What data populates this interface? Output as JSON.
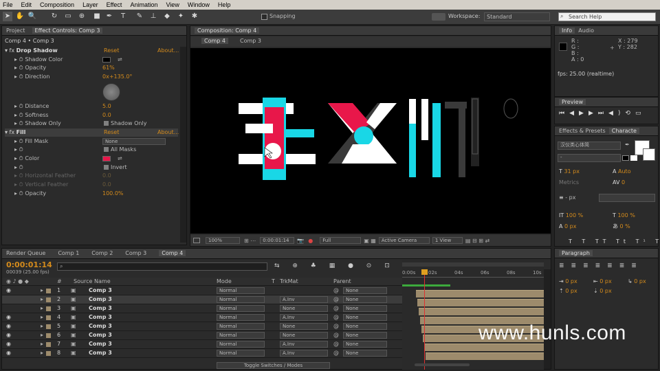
{
  "menu": [
    "File",
    "Edit",
    "Composition",
    "Layer",
    "Effect",
    "Animation",
    "View",
    "Window",
    "Help"
  ],
  "toolbar": {
    "snapping": "Snapping",
    "workspace_label": "Workspace:",
    "workspace_value": "Standard",
    "search_placeholder": "Search Help"
  },
  "project_panel": {
    "tab_project": "Project",
    "tab_effect_controls": "Effect Controls: Comp 3",
    "breadcrumb": "Comp 4 • Comp 3",
    "effects": [
      {
        "name": "Drop Shadow",
        "reset": "Reset",
        "about": "About...",
        "props": [
          {
            "label": "Shadow Color",
            "value": ""
          },
          {
            "label": "Opacity",
            "value": "61%"
          },
          {
            "label": "Direction",
            "value": "0x+135.0°"
          },
          {
            "label": "Distance",
            "value": "5.0"
          },
          {
            "label": "Softness",
            "value": "0.0"
          },
          {
            "label": "Shadow Only",
            "value": "Shadow Only"
          }
        ]
      },
      {
        "name": "Fill",
        "reset": "Reset",
        "about": "About...",
        "props": [
          {
            "label": "Fill Mask",
            "value": "None"
          },
          {
            "label": "",
            "value": "All Masks"
          },
          {
            "label": "Color",
            "value": ""
          },
          {
            "label": "",
            "value": "Invert"
          },
          {
            "label": "Horizontal Feather",
            "value": "0.0"
          },
          {
            "label": "Vertical Feather",
            "value": "0.0"
          },
          {
            "label": "Opacity",
            "value": "100.0%"
          }
        ]
      }
    ]
  },
  "composition_panel": {
    "tab": "Composition: Comp 4",
    "subtabs": [
      "Comp 4",
      "Comp 3"
    ],
    "footer": {
      "zoom": "100%",
      "timecode": "0:00:01:14",
      "resolution": "Full",
      "camera": "Active Camera",
      "view": "1 View"
    }
  },
  "info_panel": {
    "tab_info": "Info",
    "tab_audio": "Audio",
    "r": "R :",
    "g": "G :",
    "b": "B :",
    "a": "A : 0",
    "x": "X : 279",
    "y": "Y : 282",
    "fps": "fps: 25.00 (realtime)"
  },
  "preview_panel": {
    "tab": "Preview"
  },
  "effects_presets": {
    "tab1": "Effects & Presets",
    "tab2": "Characte"
  },
  "character": {
    "font": "汉仪类心体简",
    "style": "-",
    "size": "31 px",
    "leading": "Auto",
    "kerning": "Metrics",
    "tracking": "0",
    "stroke": "- px",
    "vscale": "100 %",
    "hscale": "100 %",
    "baseline": "0 px",
    "tsume": "0 %"
  },
  "paragraph": {
    "tab": "Paragraph",
    "indent_vals": [
      "0 px",
      "0 px",
      "0 px",
      "0 px",
      "0 px"
    ]
  },
  "timeline": {
    "tabs": [
      "Render Queue",
      "Comp 1",
      "Comp 2",
      "Comp 3",
      "Comp 4"
    ],
    "timecode": "0:00:01:14",
    "frames": "00039 (25.00 fps)",
    "columns": {
      "source": "Source Name",
      "mode": "Mode",
      "t": "T",
      "trkmat": "TrkMat",
      "parent": "Parent"
    },
    "ruler": [
      "0:00s",
      "02s",
      "04s",
      "06s",
      "08s",
      "10s"
    ],
    "layers": [
      {
        "num": "1",
        "name": "Comp 3",
        "mode": "Normal",
        "trkmat": "",
        "parent": "None",
        "selected": false
      },
      {
        "num": "2",
        "name": "Comp 3",
        "mode": "Normal",
        "trkmat": "A.Inv",
        "parent": "None",
        "selected": true
      },
      {
        "num": "3",
        "name": "Comp 3",
        "mode": "Normal",
        "trkmat": "None",
        "parent": "None",
        "selected": false
      },
      {
        "num": "4",
        "name": "Comp 3",
        "mode": "Normal",
        "trkmat": "A.Inv",
        "parent": "None",
        "selected": false
      },
      {
        "num": "5",
        "name": "Comp 3",
        "mode": "Normal",
        "trkmat": "None",
        "parent": "None",
        "selected": false
      },
      {
        "num": "6",
        "name": "Comp 3",
        "mode": "Normal",
        "trkmat": "None",
        "parent": "None",
        "selected": false
      },
      {
        "num": "7",
        "name": "Comp 3",
        "mode": "Normal",
        "trkmat": "A.Inv",
        "parent": "None",
        "selected": false
      },
      {
        "num": "8",
        "name": "Comp 3",
        "mode": "Normal",
        "trkmat": "A.Inv",
        "parent": "None",
        "selected": false
      }
    ],
    "toggle": "Toggle Switches / Modes"
  },
  "watermark": "www.hunls.com",
  "colors": {
    "accent": "#d48b1c",
    "red": "#e8174a",
    "cyan": "#19d7e6",
    "fill_swatch": "#e8174a"
  }
}
